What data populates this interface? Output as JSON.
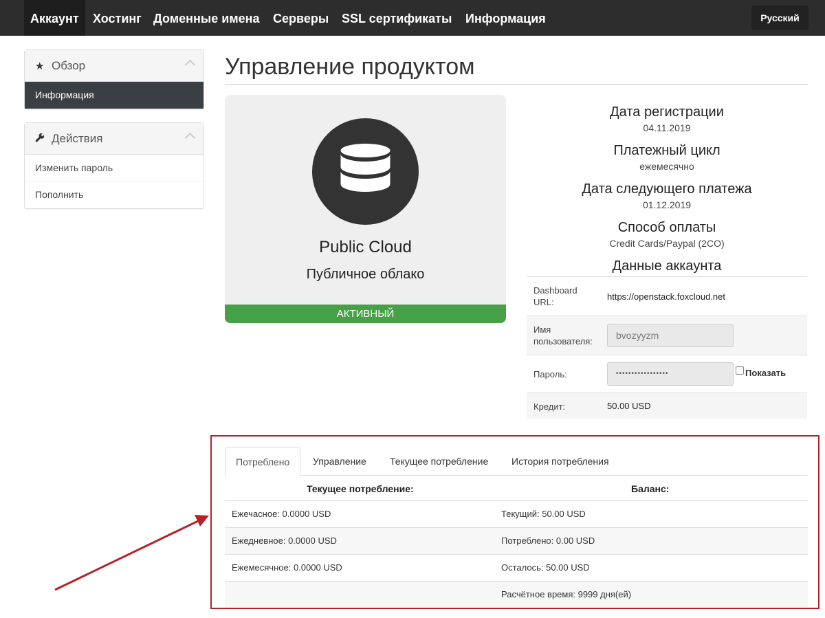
{
  "nav": {
    "items": [
      "Аккаунт",
      "Хостинг",
      "Доменные имена",
      "Серверы",
      "SSL сертификаты",
      "Информация"
    ],
    "language": "Русский"
  },
  "sidebar": {
    "overview": {
      "title": "Обзор",
      "items": [
        "Информация"
      ]
    },
    "actions": {
      "title": "Действия",
      "items": [
        "Изменить пароль",
        "Пополнить"
      ]
    }
  },
  "page": {
    "title": "Управление продуктом"
  },
  "product": {
    "name": "Public Cloud",
    "subtitle": "Публичное облако",
    "status": "АКТИВНЫЙ",
    "icon": "database-icon"
  },
  "info": {
    "reg_date_label": "Дата регистрации",
    "reg_date": "04.11.2019",
    "billing_cycle_label": "Платежный цикл",
    "billing_cycle": "ежемесячно",
    "next_payment_label": "Дата следующего платежа",
    "next_payment": "01.12.2019",
    "payment_method_label": "Способ оплаты",
    "payment_method": "Credit Cards/Paypal (2CO)",
    "account_data_label": "Данные аккаунта"
  },
  "account": {
    "dashboard_label_1": "Dashboard",
    "dashboard_label_2": "URL:",
    "dashboard_url": "https://openstack.foxcloud.net",
    "username_label_1": "Имя",
    "username_label_2": "пользователя:",
    "username": "bvozyyzm",
    "password_label": "Пароль:",
    "password_mask": "•••••••••••••••••",
    "show_label": "Показать",
    "credit_label": "Кредит:",
    "credit": "50.00 USD"
  },
  "tabs": [
    "Потреблено",
    "Управление",
    "Текущее потребление",
    "История потребления"
  ],
  "consumption": {
    "left_header": "Текущее потребление:",
    "right_header": "Баланс:",
    "rows": [
      {
        "left": "Ежечасное: 0.0000 USD",
        "right": "Текущий: 50.00 USD"
      },
      {
        "left": "Ежедневное: 0.0000 USD",
        "right": "Потреблено: 0.00 USD"
      },
      {
        "left": "Ежемесячное: 0.0000 USD",
        "right": "Осталось: 50.00 USD"
      },
      {
        "left": "",
        "right": "Расчётное время: 9999 дня(ей)"
      }
    ]
  },
  "colors": {
    "nav_bg": "#2d2d2d",
    "status_green": "#46a046",
    "highlight_red": "#b52328"
  }
}
